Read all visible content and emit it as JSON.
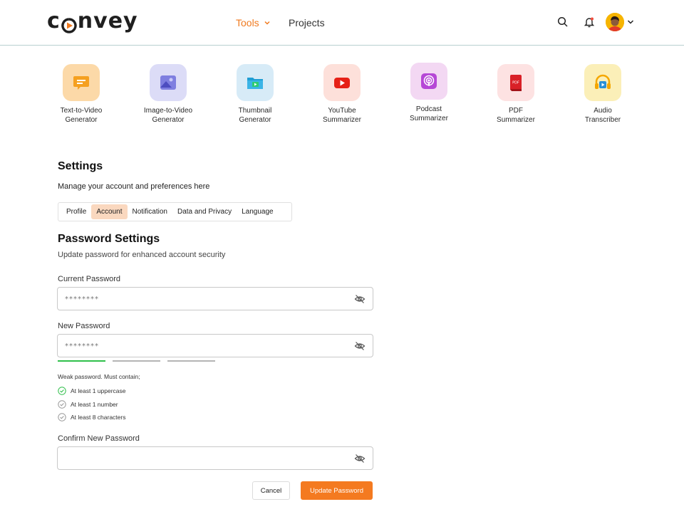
{
  "header": {
    "logo_text_left": "c",
    "logo_text_right": "nvey",
    "nav": {
      "tools_label": "Tools",
      "projects_label": "Projects"
    },
    "accent_color": "#f07a1f"
  },
  "tools": [
    {
      "label": "Text-to-Video Generator",
      "line1": "Text-to-Video",
      "line2": "Generator",
      "icon": "text-to-video-icon",
      "color": "#fcd9a8"
    },
    {
      "label": "Image-to-Video Generator",
      "line1": "Image-to-Video",
      "line2": "Generator",
      "icon": "image-icon",
      "color": "#dcdcf7"
    },
    {
      "label": "Thumbnail Generator",
      "line1": "Thumbnail",
      "line2": "Generator",
      "icon": "thumbnail-folder-icon",
      "color": "#d7ebf7"
    },
    {
      "label": "YouTube Summarizer",
      "line1": "YouTube",
      "line2": "Summarizer",
      "icon": "youtube-icon",
      "color": "#fde0da"
    },
    {
      "label": "Podcast Summarizer",
      "line1": "Podcast",
      "line2": "Summarizer",
      "icon": "podcast-icon",
      "color": "#f3d8f3"
    },
    {
      "label": "PDF Summarizer",
      "line1": "PDF",
      "line2": "Summarizer",
      "icon": "pdf-icon",
      "color": "#fde2e2"
    },
    {
      "label": "Audio Transcriber",
      "line1": "Audio",
      "line2": "Transcriber",
      "icon": "headphones-icon",
      "color": "#fbefb8"
    }
  ],
  "settings": {
    "title": "Settings",
    "subtitle": "Manage your account and preferences here",
    "tabs": [
      "Profile",
      "Account",
      "Notification",
      "Data and Privacy",
      "Language"
    ],
    "active_tab": "Account"
  },
  "password": {
    "title": "Password Settings",
    "subtitle": "Update password for enhanced account security",
    "current_label": "Current Password",
    "current_value": "********",
    "new_label": "New Password",
    "new_value": "********",
    "confirm_label": "Confirm New Password",
    "confirm_value": "",
    "strength_segments_filled": 1,
    "strength_segments_total": 3,
    "strength_color": "#2fbf4a",
    "rules_head": "Weak password. Must contain;",
    "rules": [
      {
        "text": "At least 1 uppercase",
        "met": true
      },
      {
        "text": "At least 1 number",
        "met": false
      },
      {
        "text": "At least 8 characters",
        "met": false
      }
    ],
    "cancel_label": "Cancel",
    "update_label": "Update Password"
  }
}
